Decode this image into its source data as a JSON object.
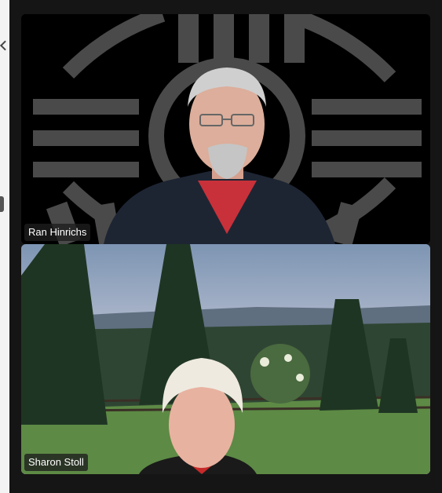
{
  "participants": [
    {
      "name": "Ran Hinrichs"
    },
    {
      "name": "Sharon Stoll"
    }
  ],
  "colors": {
    "logo_stroke": "#4a4a4a",
    "nametag_bg": "#1e1e1e",
    "nametag_text": "#ffffff"
  }
}
